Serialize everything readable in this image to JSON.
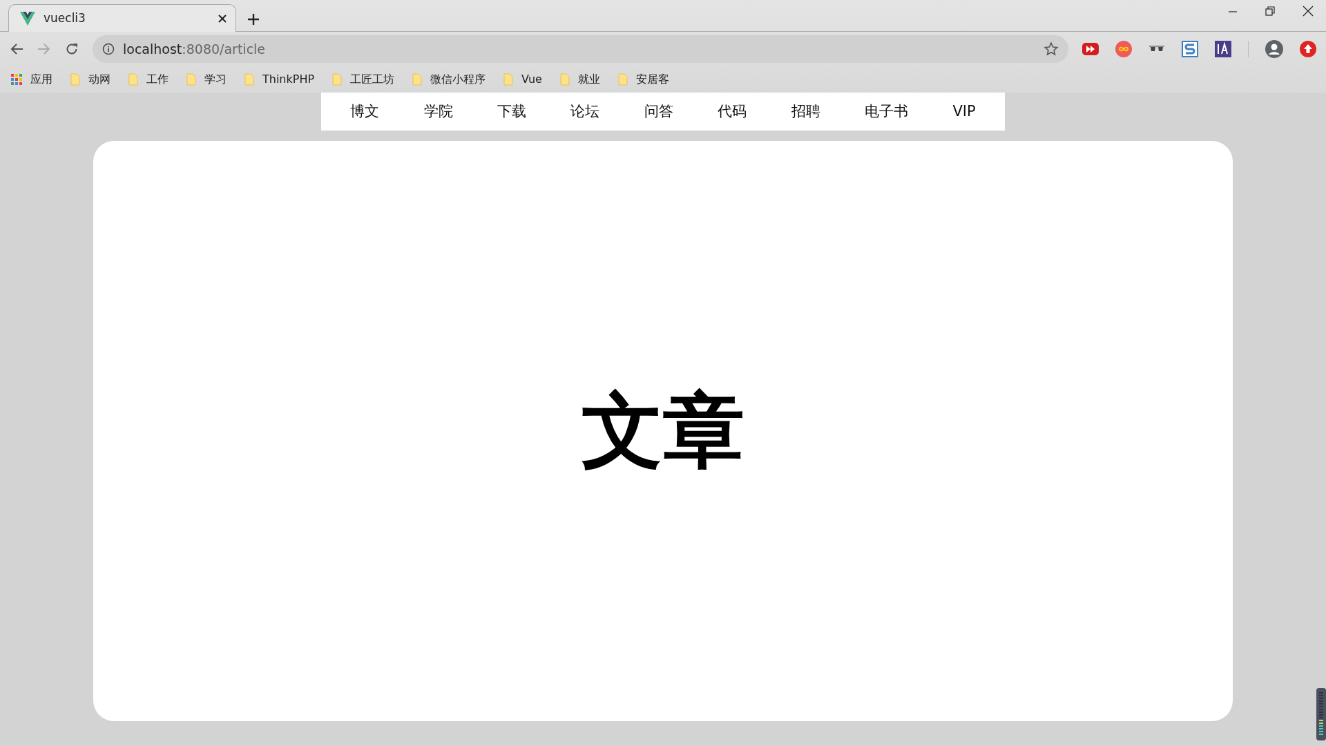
{
  "browser": {
    "tab": {
      "title": "vuecli3"
    },
    "address": {
      "host": "localhost",
      "path": ":8080/article"
    },
    "forward_disabled": true,
    "bookmarks": [
      {
        "label": "应用",
        "kind": "apps"
      },
      {
        "label": "动网",
        "kind": "folder"
      },
      {
        "label": "工作",
        "kind": "folder"
      },
      {
        "label": "学习",
        "kind": "folder"
      },
      {
        "label": "ThinkPHP",
        "kind": "folder"
      },
      {
        "label": "工匠工坊",
        "kind": "folder"
      },
      {
        "label": "微信小程序",
        "kind": "folder"
      },
      {
        "label": "Vue",
        "kind": "folder"
      },
      {
        "label": "就业",
        "kind": "folder"
      },
      {
        "label": "安居客",
        "kind": "folder"
      }
    ]
  },
  "nav": {
    "items": [
      "博文",
      "学院",
      "下载",
      "论坛",
      "问答",
      "代码",
      "招聘",
      "电子书",
      "VIP"
    ]
  },
  "content": {
    "heading": "文章"
  }
}
